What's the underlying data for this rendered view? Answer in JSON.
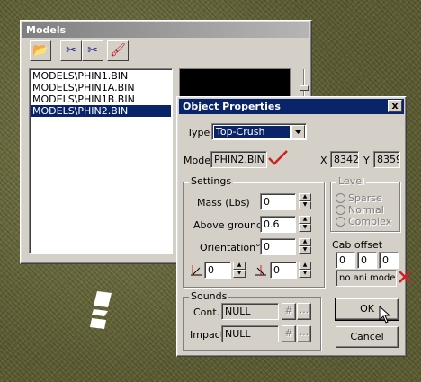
{
  "models_window": {
    "title": "Models",
    "toolbar": [
      {
        "name": "open-folder-icon",
        "glyph": "📂"
      },
      {
        "name": "cut-icon",
        "glyph": "✂"
      },
      {
        "name": "cut-alt-icon",
        "glyph": "✂"
      },
      {
        "name": "brush-icon",
        "glyph": "🖌"
      }
    ],
    "list": [
      {
        "label": "MODELS\\PHIN1.BIN",
        "selected": false
      },
      {
        "label": "MODELS\\PHIN1A.BIN",
        "selected": false
      },
      {
        "label": "MODELS\\PHIN1B.BIN",
        "selected": false
      },
      {
        "label": "MODELS\\PHIN2.BIN",
        "selected": true
      }
    ]
  },
  "dialog": {
    "title": "Object Properties",
    "close_label": "x",
    "type_label": "Type",
    "type_value": "Top-Crush",
    "model_label": "Model",
    "model_value": "PHIN2.BIN",
    "x_label": "X",
    "x_value": "8342",
    "y_label": "Y",
    "y_value": "8359",
    "settings": {
      "title": "Settings",
      "mass_label": "Mass (Lbs)",
      "mass_value": "0",
      "above_label": "Above ground",
      "above_value": "0.6",
      "orient_label": "Orientation°",
      "orient_value": "0",
      "tilt1_value": "0",
      "tilt2_value": "0"
    },
    "level": {
      "title": "Level",
      "options": [
        "Sparse",
        "Normal",
        "Complex"
      ]
    },
    "cab_offset": {
      "title": "Cab offset",
      "values": [
        "0",
        "0",
        "0"
      ],
      "status": "no ani model!"
    },
    "sounds": {
      "title": "Sounds",
      "cont_label": "Cont.",
      "cont_value": "NULL",
      "impact_label": "Impact",
      "impact_value": "NULL",
      "hash_label": "#",
      "more_label": "..."
    },
    "ok_label": "OK",
    "cancel_label": "Cancel"
  },
  "colors": {
    "title_active": "#0a246a",
    "selection": "#0a246a",
    "window_face": "#d4d0c8",
    "check_red": "#cc2222"
  }
}
